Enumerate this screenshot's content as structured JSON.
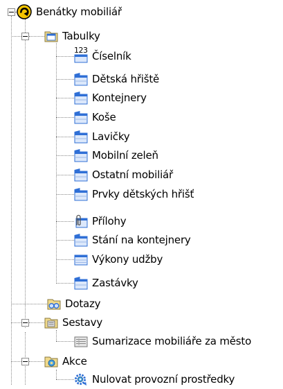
{
  "tree": {
    "root": {
      "label": "Benátky mobiliář",
      "icon": "yellow-arrow-logo-icon",
      "expanded": true
    },
    "tabulky": {
      "label": "Tabulky",
      "icon": "table-folder-icon",
      "expanded": true,
      "items": [
        {
          "label": "Číselník",
          "icon": "codebook-table-icon",
          "badge": "123"
        },
        {
          "label": "Dětská hřiště",
          "icon": "map-layer-table-icon"
        },
        {
          "label": "Kontejnery",
          "icon": "map-layer-table-icon"
        },
        {
          "label": "Koše",
          "icon": "map-layer-table-icon"
        },
        {
          "label": "Lavičky",
          "icon": "map-layer-table-icon"
        },
        {
          "label": "Mobilní zeleň",
          "icon": "map-layer-table-icon"
        },
        {
          "label": "Ostatní mobiliář",
          "icon": "map-layer-table-icon"
        },
        {
          "label": "Prvky dětských hřišť",
          "icon": "map-layer-table-icon"
        },
        {
          "label": "Přílohy",
          "icon": "paperclip-table-icon"
        },
        {
          "label": "Stání na kontejnery",
          "icon": "map-layer-table-icon"
        },
        {
          "label": "Výkony udžby",
          "icon": "table-icon"
        },
        {
          "label": "Zastávky",
          "icon": "map-layer-table-icon"
        }
      ]
    },
    "dotazy": {
      "label": "Dotazy",
      "icon": "query-glasses-folder-icon"
    },
    "sestavy": {
      "label": "Sestavy",
      "icon": "report-folder-icon",
      "expanded": true,
      "items": [
        {
          "label": "Sumarizace mobiliáře za město",
          "icon": "report-icon"
        }
      ]
    },
    "akce": {
      "label": "Akce",
      "icon": "action-folder-icon",
      "expanded": true,
      "items": [
        {
          "label": "Nulovat provozní prostředky",
          "icon": "gear-action-icon"
        }
      ]
    }
  },
  "colors": {
    "tree_line": "#8a8a8a",
    "table_blue": "#2f6fd6",
    "folder_yellow": "#f0d98a",
    "root_yellow": "#f5c400"
  }
}
